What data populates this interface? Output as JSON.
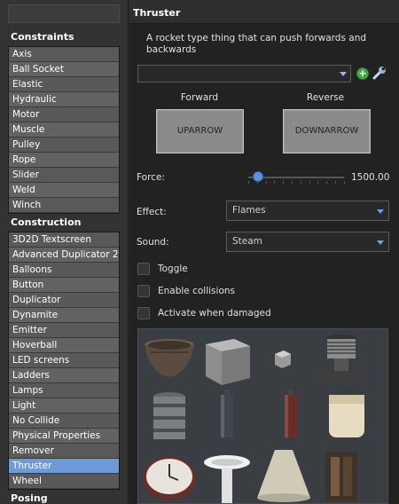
{
  "search": {
    "placeholder": ""
  },
  "categories": [
    {
      "name": "Constraints",
      "items": [
        "Axis",
        "Ball Socket",
        "Elastic",
        "Hydraulic",
        "Motor",
        "Muscle",
        "Pulley",
        "Rope",
        "Slider",
        "Weld",
        "Winch"
      ]
    },
    {
      "name": "Construction",
      "items": [
        "3D2D Textscreen",
        "Advanced Duplicator 2",
        "Balloons",
        "Button",
        "Duplicator",
        "Dynamite",
        "Emitter",
        "Hoverball",
        "LED screens",
        "Ladders",
        "Lamps",
        "Light",
        "No Collide",
        "Physical Properties",
        "Remover",
        "Thruster",
        "Wheel"
      ],
      "selected": "Thruster"
    },
    {
      "name": "Posing",
      "items": []
    }
  ],
  "tool": {
    "title": "Thruster",
    "description": "A rocket type thing that can push forwards and backwards",
    "preset_value": ""
  },
  "keys": {
    "forward_label": "Forward",
    "reverse_label": "Reverse",
    "forward_key": "UPARROW",
    "reverse_key": "DOWNARROW"
  },
  "force": {
    "label": "Force:",
    "value": "1500.00",
    "fraction": 0.1
  },
  "effect": {
    "label": "Effect:",
    "value": "Flames"
  },
  "sound": {
    "label": "Sound:",
    "value": "Steam"
  },
  "checkboxes": [
    {
      "label": "Toggle",
      "checked": false
    },
    {
      "label": "Enable collisions",
      "checked": false
    },
    {
      "label": "Activate when damaged",
      "checked": false
    }
  ],
  "models": [
    "wooden-bowl",
    "metal-cube",
    "small-cube",
    "spring-coil",
    "canister",
    "thin-cylinder-dark",
    "thin-cylinder-red",
    "paper-lantern",
    "clock",
    "sink",
    "lamp-shade",
    "machine-part"
  ],
  "colors": {
    "selected": "#6f9ad8",
    "accent": "#5e93e0"
  }
}
